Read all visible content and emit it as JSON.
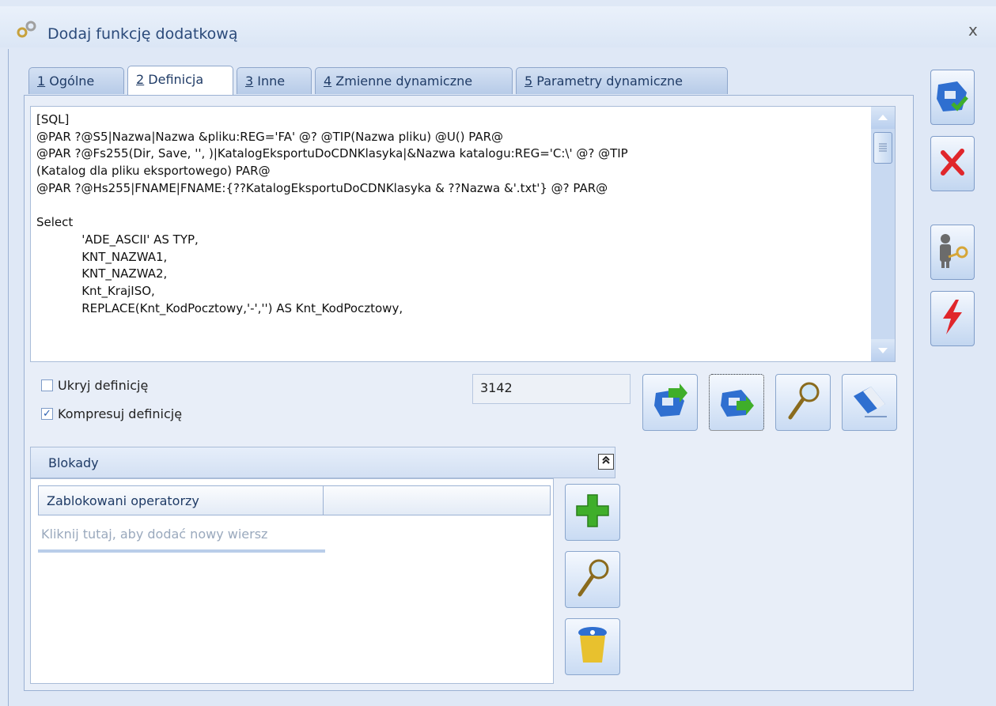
{
  "window": {
    "title": "Dodaj funkcję dodatkową",
    "close_glyph": "x"
  },
  "tabs": [
    {
      "num": "1",
      "label": "Ogólne"
    },
    {
      "num": "2",
      "label": "Definicja",
      "active": true
    },
    {
      "num": "3",
      "label": "Inne"
    },
    {
      "num": "4",
      "label": "Zmienne dynamiczne"
    },
    {
      "num": "5",
      "label": "Parametry dynamiczne"
    }
  ],
  "definition": {
    "code": "[SQL]\n@PAR ?@S5|Nazwa|Nazwa &pliku:REG='FA' @? @TIP(Nazwa pliku) @U() PAR@\n@PAR ?@Fs255(Dir, Save, '', )|KatalogEksportuDoCDNKlasyka|&Nazwa katalogu:REG='C:\\' @? @TIP\n(Katalog dla pliku eksportowego) PAR@\n@PAR ?@Hs255|FNAME|FNAME:{??KatalogEksportuDoCDNKlasyka & ??Nazwa &'.txt'} @? PAR@\n\nSelect\n            'ADE_ASCII' AS TYP,\n            KNT_NAZWA1,\n            KNT_NAZWA2,\n            Knt_KrajISO,\n            REPLACE(Knt_KodPocztowy,'-','') AS Knt_KodPocztowy,"
  },
  "options": {
    "hide_label": "Ukryj definicję",
    "hide_checked": false,
    "compress_label": "Kompresuj definicję",
    "compress_checked": true,
    "size_value": "3142"
  },
  "blokady": {
    "title": "Blokady",
    "column_header": "Zablokowani operatorzy",
    "new_row_placeholder": "Kliknij tutaj, aby dodać nowy wiersz"
  },
  "icons": {
    "save": "save-icon",
    "cancel": "cancel-icon",
    "user_key": "user-key-icon",
    "lightning": "lightning-icon",
    "import": "import-disk-icon",
    "export": "export-disk-icon",
    "preview": "magnifier-icon",
    "clear": "eraser-icon",
    "add": "plus-icon",
    "delete": "trash-icon"
  },
  "colors": {
    "accent": "#2b4a7a",
    "green": "#3fae2a",
    "red": "#e0262b"
  }
}
